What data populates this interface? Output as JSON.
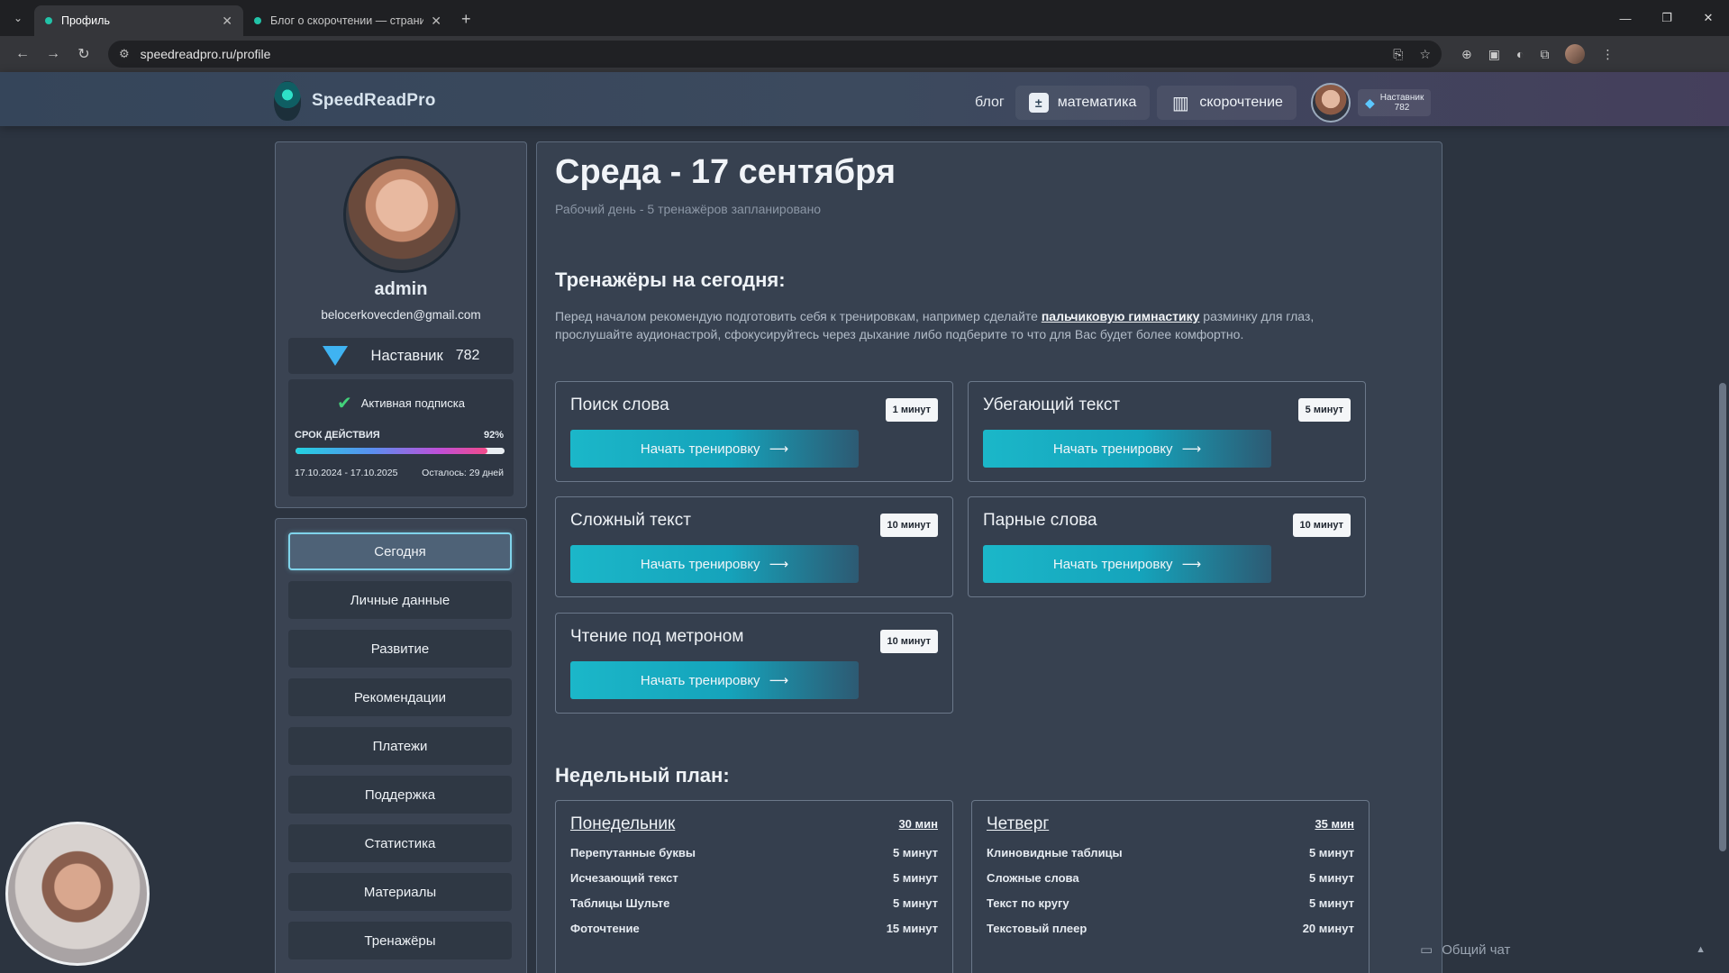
{
  "browser": {
    "tabs": [
      {
        "title": "Профиль",
        "active": true
      },
      {
        "title": "Блог о скорочтении — страни",
        "active": false
      }
    ],
    "url": "speedreadpro.ru/profile"
  },
  "header": {
    "logo_text": "SpeedReadPro",
    "nav": {
      "blog": "блог",
      "math": "математика",
      "speedreading": "скорочтение"
    },
    "rank_label": "Наставник",
    "rank_points": "782"
  },
  "profile": {
    "username": "admin",
    "email": "belocerkovecden@gmail.com",
    "rank": "Наставник",
    "points": "782",
    "subscription_status": "Активная подписка",
    "validity_label": "СРОК ДЕЙСТВИЯ",
    "validity_percent_text": "92%",
    "validity_percent": 92,
    "period": "17.10.2024 - 17.10.2025",
    "remaining": "Осталось: 29 дней"
  },
  "menu": [
    {
      "label": "Сегодня",
      "active": true
    },
    {
      "label": "Личные данные",
      "active": false
    },
    {
      "label": "Развитие",
      "active": false
    },
    {
      "label": "Рекомендации",
      "active": false
    },
    {
      "label": "Платежи",
      "active": false
    },
    {
      "label": "Поддержка",
      "active": false
    },
    {
      "label": "Статистика",
      "active": false
    },
    {
      "label": "Материалы",
      "active": false
    },
    {
      "label": "Тренажёры",
      "active": false
    }
  ],
  "main": {
    "day_title": "Среда - 17 сентября",
    "day_subtitle": "Рабочий день - 5 тренажёров запланировано",
    "trainers_heading": "Тренажёры на сегодня:",
    "intro_before": "Перед началом рекомендую подготовить себя к тренировкам, например сделайте ",
    "intro_link": "пальчиковую гимнастику",
    "intro_after": " разминку для глаз, прослушайте аудионастрой, сфокусируйтесь через дыхание либо подберите то что для Вас будет более комфортно.",
    "start_label": "Начать тренировку",
    "start_arrow": "⟶",
    "trainers": [
      {
        "name": "Поиск слова",
        "duration": "1 минут"
      },
      {
        "name": "Убегающий текст",
        "duration": "5 минут"
      },
      {
        "name": "Сложный текст",
        "duration": "10 минут"
      },
      {
        "name": "Парные слова",
        "duration": "10 минут"
      },
      {
        "name": "Чтение под метроном",
        "duration": "10 минут"
      }
    ],
    "weekly_heading": "Недельный план:",
    "week": [
      {
        "day": "Понедельник",
        "total": "30 мин",
        "items": [
          {
            "name": "Перепутанные буквы",
            "duration": "5 минут"
          },
          {
            "name": "Исчезающий текст",
            "duration": "5 минут"
          },
          {
            "name": "Таблицы Шульте",
            "duration": "5 минут"
          },
          {
            "name": "Фоточтение",
            "duration": "15 минут"
          }
        ]
      },
      {
        "day": "Четверг",
        "total": "35 мин",
        "items": [
          {
            "name": "Клиновидные таблицы",
            "duration": "5 минут"
          },
          {
            "name": "Сложные слова",
            "duration": "5 минут"
          },
          {
            "name": "Текст по кругу",
            "duration": "5 минут"
          },
          {
            "name": "Текстовый плеер",
            "duration": "20 минут"
          }
        ]
      }
    ]
  },
  "chat": {
    "label": "Общий чат"
  },
  "colors": {
    "accent": "#1bb7c9",
    "check": "#43d17a",
    "gem": "#3fb3f2"
  }
}
